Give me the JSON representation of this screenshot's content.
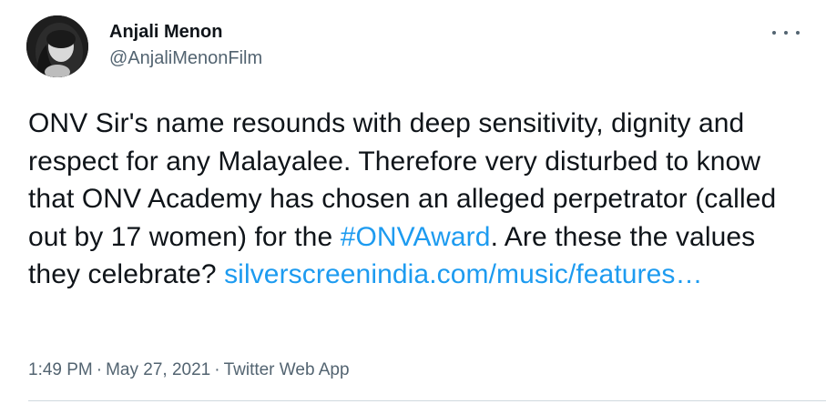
{
  "author": {
    "display_name": "Anjali Menon",
    "handle": "@AnjaliMenonFilm",
    "avatar_icon": "profile-photo"
  },
  "more_icon": "more-horizontal-icon",
  "tweet": {
    "text_1": "ONV Sir's name resounds with deep sensitivity, dignity and respect for any Malayalee. Therefore very disturbed to know that ONV Academy has chosen an alleged perpetrator (called out by 17 women) for the ",
    "hashtag": "#ONVAward",
    "text_2": ". Are these the values they celebrate? ",
    "link": "silverscreenindia.com/music/features…"
  },
  "meta": {
    "time": "1:49 PM",
    "date": "May 27, 2021",
    "separator": "·",
    "source": "Twitter Web App"
  },
  "colors": {
    "link": "#1d9bf0",
    "secondary_text": "#536471",
    "primary_text": "#0f1419"
  }
}
